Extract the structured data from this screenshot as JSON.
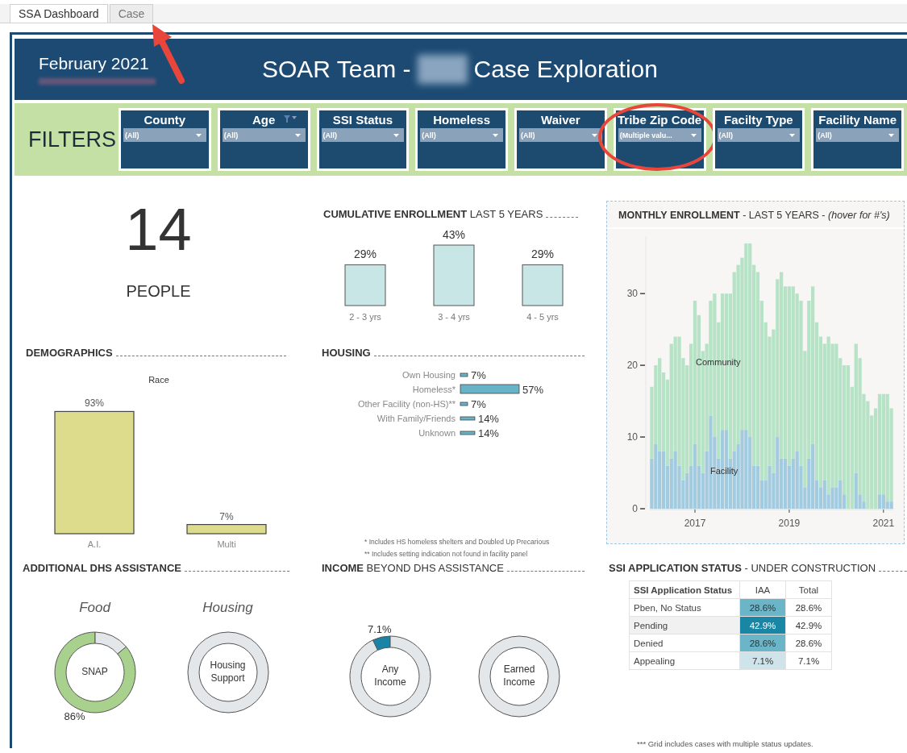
{
  "tabs": [
    {
      "label": "SSA Dashboard",
      "selected": true,
      "arrow": false
    },
    {
      "label": "Case",
      "selected": false,
      "arrow": true
    }
  ],
  "header": {
    "date": "February 2021",
    "title_start": "SOAR Team -",
    "title_end": "Case Exploration"
  },
  "filters": {
    "heading": "FILTERS",
    "items": [
      {
        "label": "County",
        "value": "(All)",
        "filtered": false,
        "circled": false
      },
      {
        "label": "Age",
        "value": "(All)",
        "filtered": true,
        "circled": false
      },
      {
        "label": "SSI Status",
        "value": "(All)",
        "filtered": false,
        "circled": false
      },
      {
        "label": "Homeless",
        "value": "(All)",
        "filtered": false,
        "circled": false
      },
      {
        "label": "Waiver",
        "value": "(All)",
        "filtered": false,
        "circled": false
      },
      {
        "label": "Tribe Zip Code",
        "value": "(Multiple valu...",
        "filtered": false,
        "circled": true
      },
      {
        "label": "Facilty Type",
        "value": "(All)",
        "filtered": false,
        "circled": false
      },
      {
        "label": "Facility Name",
        "value": "(All)",
        "filtered": false,
        "circled": false
      }
    ]
  },
  "headline": {
    "value": "14",
    "label": "PEOPLE"
  },
  "cumulative": {
    "title": "**CUMULATIVE ENROLLMENT** LAST 5 YEARS",
    "chart_data": {
      "type": "bar",
      "categories": [
        "2 - 3 yrs",
        "3 - 4 yrs",
        "4 - 5 yrs"
      ],
      "values": [
        29,
        43,
        29
      ],
      "value_labels": [
        "29%",
        "43%",
        "29%"
      ]
    }
  },
  "demographics": {
    "title": "DEMOGRAPHICS",
    "chart_data": {
      "type": "bar",
      "title": "Race",
      "categories": [
        "A.I.",
        "Multi"
      ],
      "values": [
        93,
        7
      ],
      "value_labels": [
        "93%",
        "7%"
      ]
    }
  },
  "housing": {
    "title": "HOUSING",
    "chart_data": {
      "type": "bar",
      "orientation": "horizontal",
      "categories": [
        "Own Housing",
        "Homeless*",
        "Other Facility (non-HS)**",
        "With Family/Friends",
        "Unknown"
      ],
      "values": [
        7,
        57,
        7,
        14,
        14
      ],
      "value_labels": [
        "7%",
        "57%",
        "7%",
        "14%",
        "14%"
      ]
    },
    "notes": [
      "* Includes HS homeless shelters and Doubled Up Precarious",
      "** Includes setting indication not found in facility panel"
    ]
  },
  "monthly": {
    "title": "**MONTHLY ENROLLMENT** - LAST 5 YEARS - *(hover for #'s)*",
    "chart_data": {
      "type": "bar",
      "stacked": true,
      "ylim": [
        0,
        38
      ],
      "yticks": [
        0,
        10,
        20,
        30
      ],
      "xlim": [
        2016.042,
        2021.208
      ],
      "xticks": [
        2017,
        2019,
        2021
      ],
      "x": [
        2016.083,
        2016.167,
        2016.25,
        2016.333,
        2016.417,
        2016.5,
        2016.583,
        2016.667,
        2016.75,
        2016.833,
        2016.917,
        2017,
        2017.083,
        2017.167,
        2017.25,
        2017.333,
        2017.417,
        2017.5,
        2017.583,
        2017.667,
        2017.75,
        2017.833,
        2017.917,
        2018,
        2018.083,
        2018.167,
        2018.25,
        2018.333,
        2018.417,
        2018.5,
        2018.583,
        2018.667,
        2018.75,
        2018.833,
        2018.917,
        2019,
        2019.083,
        2019.167,
        2019.25,
        2019.333,
        2019.417,
        2019.5,
        2019.583,
        2019.667,
        2019.75,
        2019.833,
        2019.917,
        2020,
        2020.083,
        2020.167,
        2020.25,
        2020.333,
        2020.417,
        2020.5,
        2020.583,
        2020.667,
        2020.75,
        2020.833,
        2020.917,
        2021,
        2021.083,
        2021.167
      ],
      "series": [
        {
          "name": "Facility",
          "color": "#a3cbe0",
          "values": [
            7,
            9,
            8,
            8,
            6,
            7,
            8,
            6,
            4,
            5,
            6,
            9,
            6,
            5,
            8,
            13,
            10,
            7,
            11,
            11,
            7,
            8,
            9,
            11,
            11,
            10,
            6,
            6,
            4,
            4,
            6,
            5,
            10,
            7,
            7,
            6,
            7,
            8,
            6,
            3,
            7,
            9,
            4,
            3,
            4,
            2,
            3,
            3,
            4,
            2,
            0,
            0,
            5,
            2,
            1,
            0,
            0,
            0,
            2,
            2,
            1,
            1
          ]
        },
        {
          "name": "Community",
          "color": "#b6e2c6",
          "values": [
            10,
            11,
            13,
            11,
            12,
            16,
            16,
            18,
            17,
            15,
            17,
            20,
            21,
            17,
            15,
            16,
            20,
            19,
            19,
            19,
            23,
            25,
            25,
            24,
            26,
            27,
            28,
            27,
            25,
            22,
            18,
            20,
            22,
            26,
            24,
            25,
            24,
            22,
            23,
            19,
            22,
            22,
            22,
            21,
            19,
            22,
            20,
            20,
            17,
            18,
            20,
            17,
            18,
            19,
            15,
            15,
            13,
            14,
            14,
            14,
            15,
            13
          ]
        }
      ]
    }
  },
  "assistance": {
    "title": "ADDITIONAL DHS ASSISTANCE",
    "donuts": [
      {
        "heading": "Food",
        "center": "SNAP",
        "value_label": "86%",
        "chart_data": {
          "type": "donut",
          "values": [
            86,
            14
          ]
        }
      },
      {
        "heading": "Housing",
        "center": "Housing Support"
      }
    ]
  },
  "income": {
    "title": "**INCOME** BEYOND DHS ASSISTANCE",
    "donuts": [
      {
        "center": "Any Income",
        "value_label": "7.1%",
        "chart_data": {
          "type": "donut",
          "values": [
            7.1,
            92.9
          ]
        }
      },
      {
        "center": "Earned Income"
      }
    ]
  },
  "ssi": {
    "title": "**SSI APPLICATION STATUS** - UNDER CONSTRUCTION",
    "columns": [
      "SSI Application Status",
      "IAA",
      "Total"
    ],
    "rows": [
      {
        "status": "Pben, No Status",
        "iaa": "28.6%",
        "total": "28.6%",
        "color": "#6bb5c9",
        "selected": false
      },
      {
        "status": "Pending",
        "iaa": "42.9%",
        "total": "42.9%",
        "color": "#1a86a6",
        "selected": true
      },
      {
        "status": "Denied",
        "iaa": "28.6%",
        "total": "28.6%",
        "color": "#6bb5c9",
        "selected": false
      },
      {
        "status": "Appealing",
        "iaa": "7.1%",
        "total": "7.1%",
        "color": "#cfe3ea",
        "selected": false
      }
    ],
    "note": "*** Grid includes cases with multiple status updates."
  }
}
